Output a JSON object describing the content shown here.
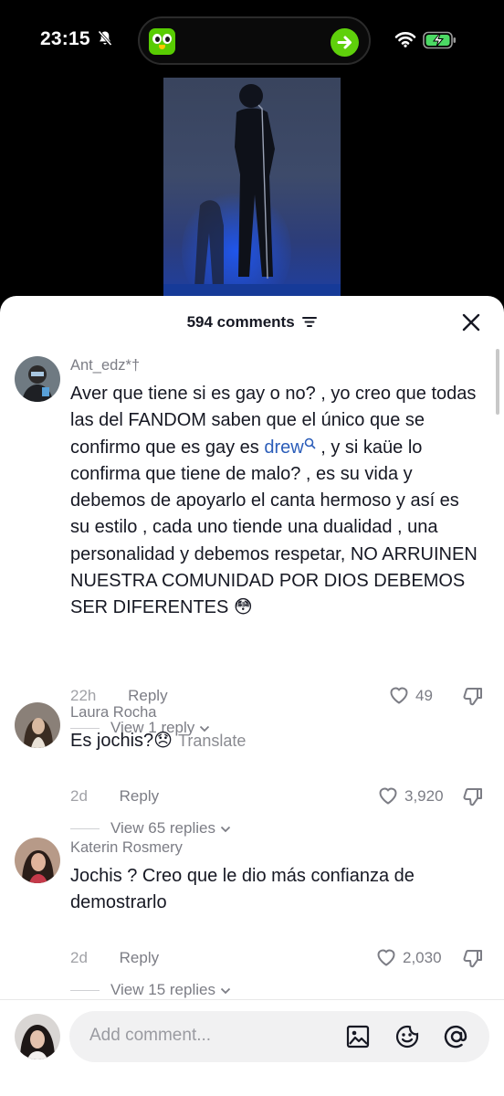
{
  "status_bar": {
    "time": "23:15"
  },
  "sheet": {
    "comment_count": "594 comments",
    "comments": [
      {
        "username": "Ant_edz*†",
        "text_before": "Aver que tiene si es gay o no? , yo creo que todas las del FANDOM saben que el único que se confirmo que es gay es ",
        "mention": "drew",
        "text_after": " , y si kaüe lo confirma que tiene de malo? , es su vida y debemos de apoyarlo el canta hermoso y así es su estilo , cada uno tiende una dualidad , una personalidad y debemos respetar, NO ARRUINEN NUESTRA COMUNIDAD POR DIOS DEBEMOS SER DIFERENTES 😳",
        "time": "22h",
        "reply": "Reply",
        "likes": "49",
        "view_replies": "View 1 reply"
      },
      {
        "username": "Laura Rocha",
        "text": "Es jochis?😞",
        "translate": "Translate",
        "time": "2d",
        "reply": "Reply",
        "likes": "3,920",
        "view_replies": "View 65 replies"
      },
      {
        "username": "Katerin Rosmery",
        "text": "Jochis ? Creo que le dio más confianza de demostrarlo",
        "time": "2d",
        "reply": "Reply",
        "likes": "2,030",
        "view_replies": "View 15 replies"
      }
    ]
  },
  "input": {
    "placeholder": "Add comment..."
  },
  "icons": {
    "filter": "filter-icon",
    "close": "close-icon",
    "like": "heart-icon",
    "dislike": "dislike-icon",
    "image": "image-icon",
    "sticker": "sticker-icon",
    "mention": "at-icon",
    "mute": "bell-slash-icon",
    "wifi": "wifi-icon",
    "battery": "battery-charging-icon",
    "duolingo": "duolingo-owl-icon",
    "arrow": "arrow-right-icon"
  },
  "colors": {
    "mention": "#2b5db9",
    "duolingo": "#58cc02",
    "battery": "#4cd964"
  }
}
